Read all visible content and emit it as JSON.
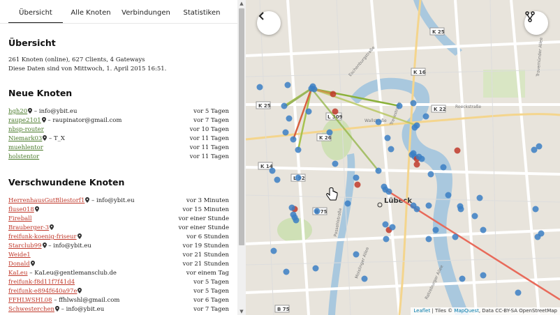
{
  "tabs": [
    "Übersicht",
    "Alle Knoten",
    "Verbindungen",
    "Statistiken"
  ],
  "overview": {
    "title": "Übersicht",
    "stats": "261 Knoten (online), 627 Clients, 4 Gateways",
    "updated": "Diese Daten sind von Mittwoch, 1. April 2015 16:51."
  },
  "new_nodes": {
    "title": "Neue Knoten",
    "items": [
      {
        "name": "hgh20",
        "pin": true,
        "contact": " – info@ybit.eu",
        "age": "vor 5 Tagen"
      },
      {
        "name": "raupe2101",
        "pin": true,
        "contact": " – raupinator@gmail.com",
        "age": "vor 7 Tagen"
      },
      {
        "name": "nbsp-router",
        "pin": false,
        "contact": "",
        "age": "vor 10 Tagen"
      },
      {
        "name": "Niemark03",
        "pin": true,
        "contact": " – T_X",
        "age": "vor 11 Tagen"
      },
      {
        "name": "muehlentor",
        "pin": false,
        "contact": "",
        "age": "vor 11 Tagen"
      },
      {
        "name": "holstentor",
        "pin": false,
        "contact": "",
        "age": "vor 11 Tagen"
      }
    ]
  },
  "lost_nodes": {
    "title": "Verschwundene Knoten",
    "items": [
      {
        "name": "HerrenhausGutBliestorf1",
        "pin": true,
        "contact": " – info@ybit.eu",
        "age": "vor 3 Minuten"
      },
      {
        "name": "fluse018",
        "pin": true,
        "contact": "",
        "age": "vor 15 Minuten"
      },
      {
        "name": "Fireball",
        "pin": false,
        "contact": "",
        "age": "vor einer Stunde"
      },
      {
        "name": "Brauberger-3",
        "pin": true,
        "contact": "",
        "age": "vor einer Stunde"
      },
      {
        "name": "freifunk-koenig-friseur",
        "pin": true,
        "contact": "",
        "age": "vor 6 Stunden"
      },
      {
        "name": "Starclub99",
        "pin": true,
        "contact": " – info@ybit.eu",
        "age": "vor 19 Stunden"
      },
      {
        "name": "Weide1",
        "pin": false,
        "contact": "",
        "age": "vor 21 Stunden"
      },
      {
        "name": "Donald",
        "pin": true,
        "contact": "",
        "age": "vor 21 Stunden"
      },
      {
        "name": "KaLeu",
        "pin": false,
        "contact": " – KaLeu@gentlemansclub.de",
        "age": "vor einem Tag"
      },
      {
        "name": "freifunk-f8d11f7f41d4",
        "pin": false,
        "contact": "",
        "age": "vor 5 Tagen"
      },
      {
        "name": "freifunk-e894f640a97e",
        "pin": true,
        "contact": "",
        "age": "vor 5 Tagen"
      },
      {
        "name": "FFHLWSHL08",
        "pin": false,
        "contact": " – ffhlwshl@gmail.com",
        "age": "vor 6 Tagen"
      },
      {
        "name": "Schwesterchen",
        "pin": true,
        "contact": " – info@ybit.eu",
        "age": "vor 7 Tagen"
      }
    ]
  },
  "map": {
    "city_label": "Lübeck",
    "road_labels": [
      "K 25",
      "K 16",
      "K 22",
      "K 25",
      "L 309",
      "K 26",
      "K 14",
      "L 92",
      "B 75",
      "B 75"
    ],
    "street_labels": [
      "Travemünder Allee",
      "Eschenburgstraße",
      "Roeckstraße",
      "Wallstraße",
      "Possehlstraße",
      "Ratzeburger Allee",
      "Moislinger Allee",
      "Travestraße"
    ],
    "attribution_leaflet": "Leaflet",
    "attribution_tiles": " | Tiles © ",
    "attribution_mapquest": "MapQuest",
    "attribution_rest": ", Data CC-BY-SA OpenStreetMap",
    "colors": {
      "online": "#3b7fc4",
      "offline": "#c0392b",
      "link_good": "#8bb13a",
      "link_bad": "#e86a5a"
    }
  },
  "controls": {
    "back_icon": "chevron-left-icon",
    "layers_icon": "fork-icon"
  }
}
